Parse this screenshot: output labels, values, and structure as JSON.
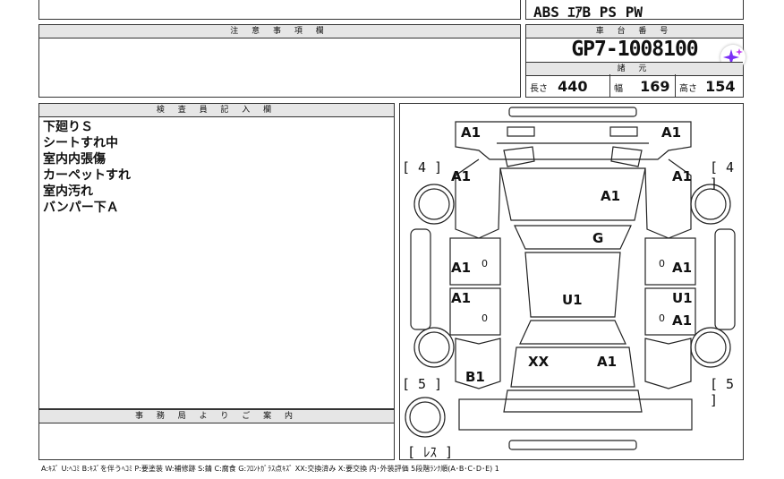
{
  "top_equipment": "ABS ｴｱB PS PW",
  "caution": {
    "header": "注 意 事 項 欄",
    "content": ""
  },
  "chassis": {
    "header": "車 台 番 号",
    "number": "GP7-1008100"
  },
  "specs": {
    "header": "諸 元",
    "length_label": "長さ",
    "length_value": "440",
    "width_label": "幅",
    "width_value": "169",
    "height_label": "高さ",
    "height_value": "154"
  },
  "inspector": {
    "header": "検 査 員 記 入 欄",
    "notes": [
      "下廻りＳ",
      "シートすれ中",
      "室内内張傷",
      "カーペットすれ",
      "室内汚れ",
      "バンパー下Ａ"
    ]
  },
  "office": {
    "header": "事 務 局 よ り ご 案 内",
    "content": ""
  },
  "diagram": {
    "labels": {
      "tire_fl": "[ 4 ]",
      "tire_fr": "[ 4 ]",
      "tire_rl": "[ 5 ]",
      "tire_rr": "[ 5 ]",
      "spare": "[ ﾚｽ ]",
      "front_left_corner": "A1",
      "front_right_corner": "A1",
      "front_left_fender": "A1",
      "front_right_fender": "A1",
      "hood": "A1",
      "roof": "G",
      "left_front_door": "A1",
      "right_front_door": "A1",
      "left_rear_door": "A1",
      "right_rear_door": "U1",
      "right_rear_door_2": "A1",
      "center": "U1",
      "left_rear": "B1",
      "rear_left": "XX",
      "rear_right": "A1",
      "zero_1": "0",
      "zero_2": "0",
      "zero_3": "0",
      "zero_4": "0"
    }
  },
  "legend": "A:ｷｽﾞ U:ﾍｺﾐ B:ｷｽﾞを伴うﾍｺﾐ P:要塗装 W:補修跡 S:錆 C:腐食 G:ﾌﾛﾝﾄｶﾞﾗｽ点ｷｽﾞ XX:交換済み X:要交換 内･外装評価 5段階ﾗﾝｸ順(A･B･C･D･E) 1",
  "colors": {
    "accent_star": "#7b2ff7",
    "header_bg": "#e6e6e6"
  }
}
